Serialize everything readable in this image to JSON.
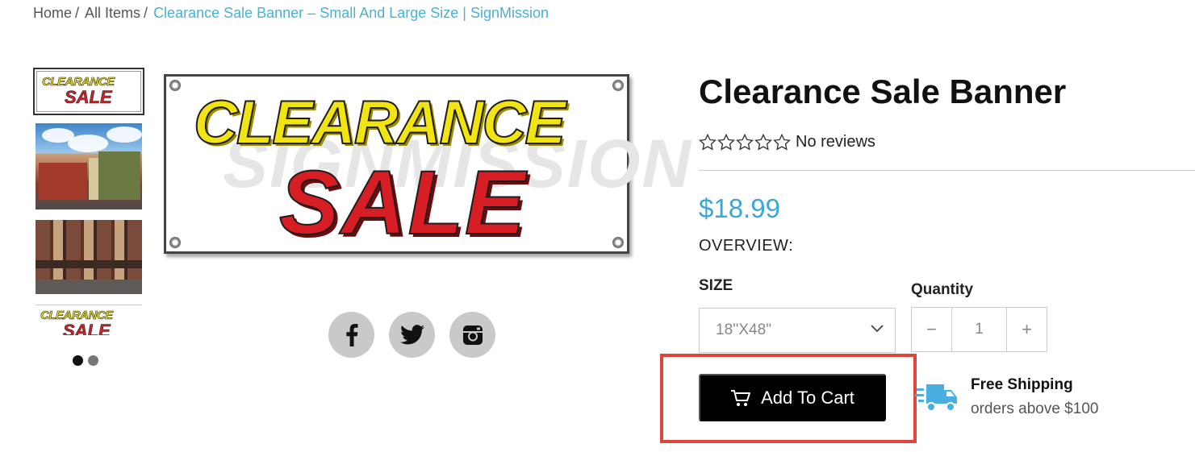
{
  "breadcrumb": {
    "items": [
      "Home",
      "All Items"
    ],
    "separator": "/",
    "current": "Clearance Sale Banner – Small And Large Size | SignMission"
  },
  "gallery": {
    "main_image": {
      "line1": "CLEARANCE",
      "line2": "SALE",
      "watermark": "SIGNMISSION"
    },
    "thumbnail_banner": {
      "line1": "CLEARANCE",
      "line2": "SALE"
    },
    "dots_count": 2,
    "active_dot": 0
  },
  "social": {
    "icons": [
      "facebook-icon",
      "twitter-icon",
      "instagram-icon"
    ]
  },
  "product": {
    "title": "Clearance Sale Banner",
    "reviews_text": "No reviews",
    "star_count": 5,
    "rating": 0,
    "price": "$18.99",
    "overview_label": "OVERVIEW:",
    "size_label": "SIZE",
    "size_value": "18''X48\"",
    "quantity_label": "Quantity",
    "quantity_value": "1",
    "minus_label": "−",
    "plus_label": "+",
    "add_to_cart_label": "Add To Cart"
  },
  "shipping": {
    "title": "Free Shipping",
    "subtitle": "orders above $100"
  },
  "colors": {
    "accent": "#3aa7d8",
    "button_bg": "#000000",
    "highlight_border": "#e2443a",
    "shipping_icon": "#4aaee0"
  }
}
